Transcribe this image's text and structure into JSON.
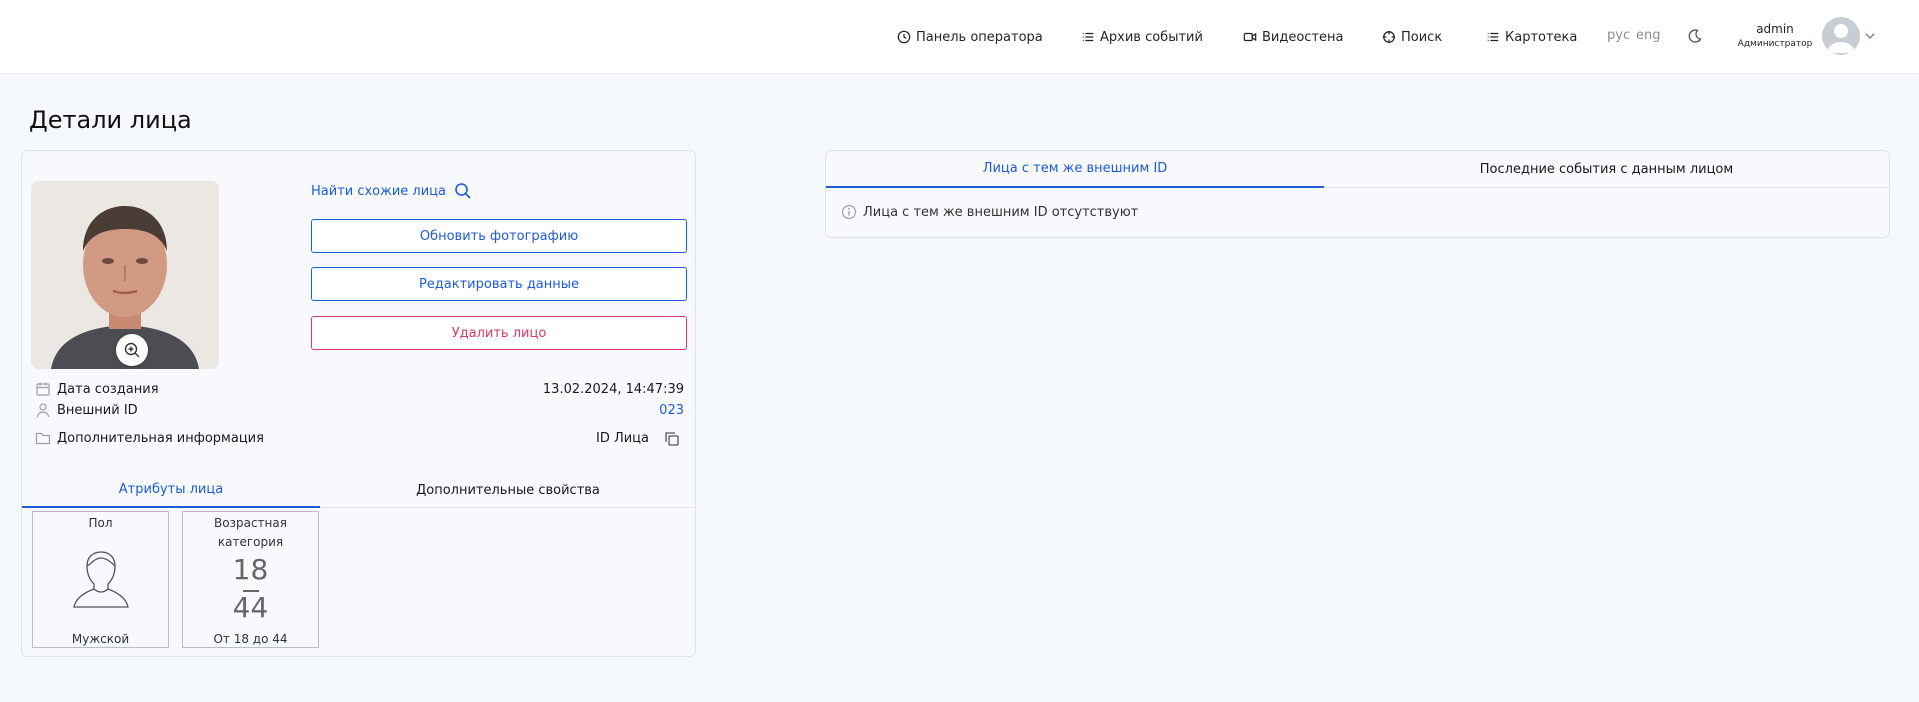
{
  "header": {
    "nav": [
      {
        "label": "Панель оператора",
        "icon": "clock-icon"
      },
      {
        "label": "Архив событий",
        "icon": "list-icon"
      },
      {
        "label": "Видеостена",
        "icon": "video-camera-icon"
      },
      {
        "label": "Поиск",
        "icon": "crosshair-icon"
      },
      {
        "label": "Картотека",
        "icon": "list-icon"
      }
    ],
    "lang_ru": "рус",
    "lang_en": "eng",
    "user_name": "admin",
    "user_role": "Администратор"
  },
  "page": {
    "title": "Детали лица"
  },
  "face_card": {
    "find_similar": "Найти схожие лица",
    "update_photo": "Обновить фотографию",
    "edit_data": "Редактировать данные",
    "delete_face": "Удалить лицо",
    "created_label": "Дата создания",
    "created_value": "13.02.2024, 14:47:39",
    "external_id_label": "Внешний ID",
    "external_id_value": "023",
    "extra_info_label": "Дополнительная информация",
    "face_id_label": "ID Лица",
    "tabs": [
      "Атрибуты лица",
      "Дополнительные свойства"
    ],
    "attributes": {
      "gender_title": "Пол",
      "gender_value": "Мужской",
      "age_title_1": "Возрастная",
      "age_title_2": "категория",
      "age_min": "18",
      "age_max": "44",
      "age_value": "От 18 до 44"
    }
  },
  "related": {
    "tabs": [
      "Лица с тем же внешним ID",
      "Последние события с данным лицом"
    ],
    "empty_notice": "Лица с тем же внешним ID отсутствуют"
  },
  "colors": {
    "accent": "#1e5bd6",
    "danger": "#d63a6a",
    "background": "#f5f8fc"
  }
}
